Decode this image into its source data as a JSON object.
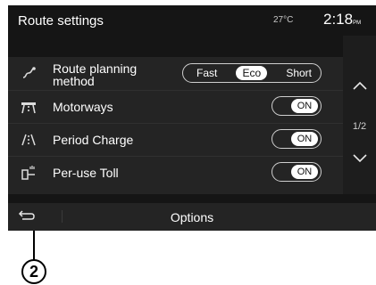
{
  "header": {
    "title": "Route settings",
    "temperature": "27°C",
    "time": "2:18",
    "ampm": "PM"
  },
  "rows": [
    {
      "label_line1": "Route planning",
      "label_line2": "method",
      "icon": "route-icon",
      "options": [
        "Fast",
        "Eco",
        "Short"
      ],
      "selected": "Eco"
    },
    {
      "label": "Motorways",
      "icon": "motorway-icon",
      "toggle": "ON"
    },
    {
      "label": "Period Charge",
      "icon": "period-charge-icon",
      "toggle": "ON"
    },
    {
      "label": "Per-use Toll",
      "icon": "toll-icon",
      "toggle": "ON"
    }
  ],
  "pager": {
    "indicator": "1/2",
    "up_icon": "chevron-up-icon",
    "down_icon": "chevron-down-icon"
  },
  "bottom": {
    "back_icon": "back-arrow-icon",
    "options_label": "Options"
  },
  "callout": {
    "number": "2"
  }
}
